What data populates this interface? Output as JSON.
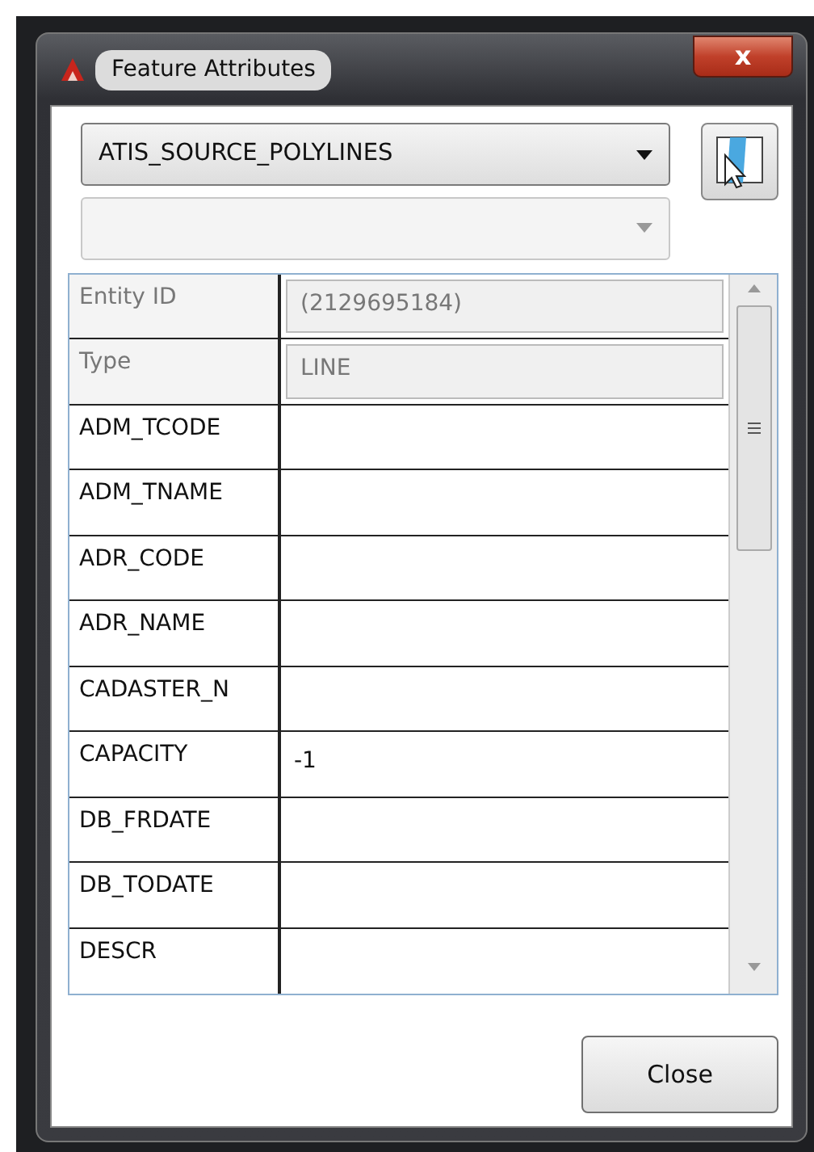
{
  "window": {
    "title": "Feature Attributes",
    "close_label": "x"
  },
  "layer_select": {
    "value": "ATIS_SOURCE_POLYLINES"
  },
  "sub_select": {
    "disabled": true
  },
  "attributes": [
    {
      "label": "Entity ID",
      "value": "(2129695184)",
      "read_only": true
    },
    {
      "label": "Type",
      "value": "LINE",
      "read_only": true
    },
    {
      "label": "ADM_TCODE",
      "read_only": false
    },
    {
      "label": "ADM_TNAME",
      "read_only": false
    },
    {
      "label": "ADR_CODE",
      "read_only": false
    },
    {
      "label": "ADR_NAME",
      "read_only": false
    },
    {
      "label": "CADASTER_N",
      "read_only": false
    },
    {
      "label": "CAPACITY",
      "value": "-1",
      "read_only": false
    },
    {
      "label": "DB_FRDATE",
      "read_only": false
    },
    {
      "label": "DB_TODATE",
      "read_only": false
    },
    {
      "label": "DESCR",
      "read_only": false
    }
  ],
  "buttons": [
    {
      "label": "Close"
    }
  ]
}
